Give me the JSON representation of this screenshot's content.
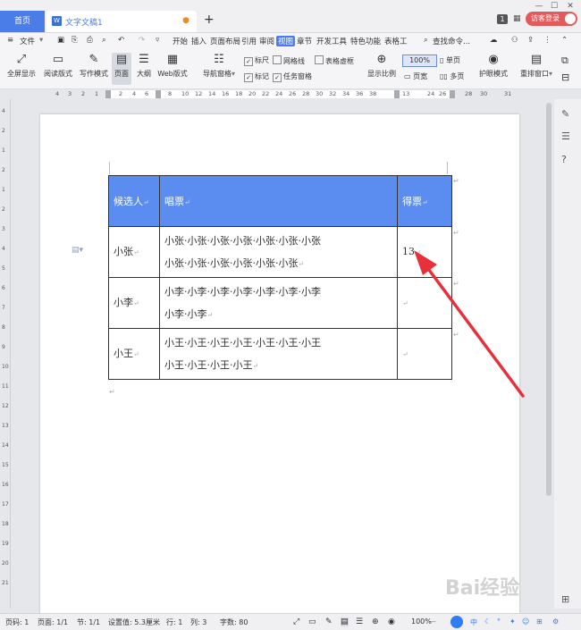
{
  "titlebar": {
    "home_tab": "首页",
    "doc_tab": "文字文稿1",
    "doc_icon": "W",
    "new_tab": "+",
    "badge": "1",
    "visitor": "访客登录"
  },
  "menu": {
    "file": "文件",
    "items": [
      "开始",
      "插入",
      "页面布局",
      "引用",
      "审阅",
      "视图",
      "章节",
      "开发工具",
      "特色功能",
      "表格工"
    ],
    "active": "视图",
    "search": "查找命令..."
  },
  "ribbon": {
    "buttons": [
      "全屏显示",
      "阅读版式",
      "写作模式",
      "页面",
      "大纲",
      "Web版式"
    ],
    "nav_pane": "导航窗格",
    "checks": [
      {
        "label": "标尺",
        "checked": true
      },
      {
        "label": "网格线",
        "checked": false
      },
      {
        "label": "表格虚框",
        "checked": false
      },
      {
        "label": "标记",
        "checked": true
      },
      {
        "label": "任务窗格",
        "checked": true
      }
    ],
    "zoom_label": "显示比例",
    "zoom_value": "100%",
    "single_page": "单页",
    "page_width": "页宽",
    "multi_page": "多页",
    "eye_mode": "护眼模式",
    "rearrange": "重排窗口"
  },
  "ruler": {
    "top_ticks": [
      "4",
      "3",
      "2",
      "1",
      "2",
      "4",
      "6",
      "8",
      "10",
      "12",
      "14",
      "16",
      "18",
      "20",
      "22",
      "24",
      "26",
      "28",
      "30",
      "32",
      "34",
      "36",
      "38",
      "13",
      "24",
      "26",
      "28",
      "30",
      "31"
    ],
    "left_ticks": [
      "4",
      "2",
      "1",
      "2",
      "1",
      "2",
      "3",
      "4",
      "5",
      "6",
      "7",
      "8",
      "9",
      "10",
      "11",
      "12",
      "13",
      "14",
      "15",
      "16",
      "17",
      "18",
      "19",
      "20",
      "21"
    ]
  },
  "document": {
    "headers": [
      "候选人",
      "唱票",
      "得票"
    ],
    "rows": [
      {
        "name": "小张",
        "votes_line1": "小张·小张·小张·小张·小张·小张·小张",
        "votes_line2": "小张·小张·小张·小张·小张·小张",
        "count": "13"
      },
      {
        "name": "小李",
        "votes_line1": "小李·小李·小李·小李·小李·小李·小李",
        "votes_line2": "小李·小李",
        "count": ""
      },
      {
        "name": "小王",
        "votes_line1": "小王·小王·小王·小王·小王·小王·小王",
        "votes_line2": "小王·小王·小王·小王",
        "count": ""
      }
    ],
    "para_mark": "↵"
  },
  "statusbar": {
    "page_num": "页码: 1",
    "pages": "页面: 1/1",
    "section": "节: 1/1",
    "setting": "设置值: 5.3厘米",
    "row": "行: 1",
    "col": "列: 3",
    "words": "字数: 80",
    "zoom": "100%",
    "ime": "中"
  },
  "watermark": "Bai经验",
  "colors": {
    "accent": "#4a7de8",
    "table_header": "#5b8df0",
    "arrow": "#e8303a",
    "visitor": "#e25a5a"
  }
}
